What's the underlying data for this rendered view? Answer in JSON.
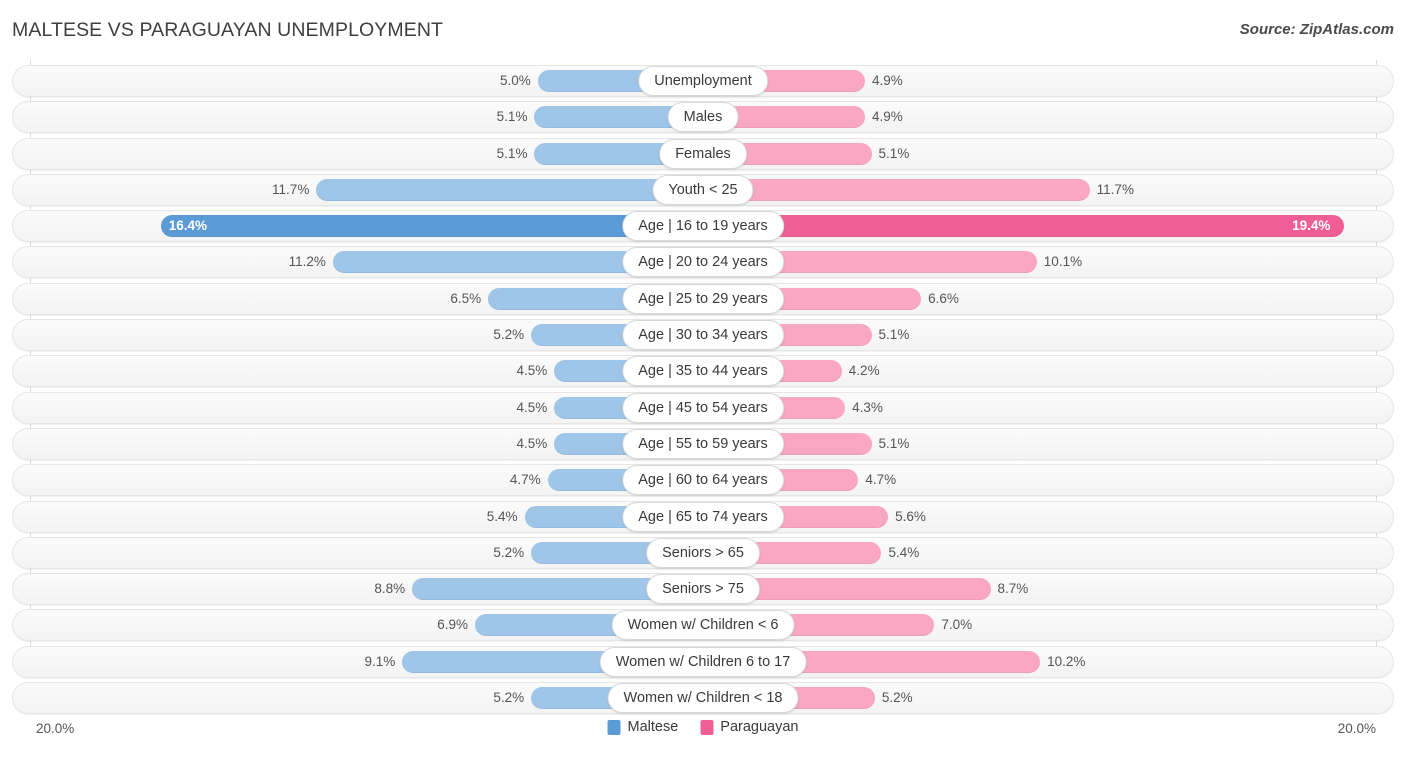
{
  "header": {
    "title": "MALTESE VS PARAGUAYAN UNEMPLOYMENT",
    "source": "Source: ZipAtlas.com"
  },
  "axis": {
    "left_label": "20.0%",
    "right_label": "20.0%",
    "max": 20.0
  },
  "legend": [
    {
      "label": "Maltese",
      "color": "#5b9bd5"
    },
    {
      "label": "Paraguayan",
      "color": "#ef5f95"
    }
  ],
  "colors": {
    "maltese_light": "#9fc5e8",
    "maltese_dark": "#5b9bd5",
    "paraguayan_light": "#f9a7c3",
    "paraguayan_dark": "#ef5f95",
    "track": "#f5f5f5",
    "gridline": "#dcdcdc"
  },
  "chart_data": {
    "type": "bar",
    "orientation": "horizontal-diverging",
    "title": "MALTESE VS PARAGUAYAN UNEMPLOYMENT",
    "xlabel": "",
    "ylabel": "",
    "xlim": [
      -20.0,
      20.0
    ],
    "grid": true,
    "legend_position": "bottom-center",
    "categories": [
      "Unemployment",
      "Males",
      "Females",
      "Youth < 25",
      "Age | 16 to 19 years",
      "Age | 20 to 24 years",
      "Age | 25 to 29 years",
      "Age | 30 to 34 years",
      "Age | 35 to 44 years",
      "Age | 45 to 54 years",
      "Age | 55 to 59 years",
      "Age | 60 to 64 years",
      "Age | 65 to 74 years",
      "Seniors > 65",
      "Seniors > 75",
      "Women w/ Children < 6",
      "Women w/ Children 6 to 17",
      "Women w/ Children < 18"
    ],
    "series": [
      {
        "name": "Maltese",
        "values": [
          5.0,
          5.1,
          5.1,
          11.7,
          16.4,
          11.2,
          6.5,
          5.2,
          4.5,
          4.5,
          4.5,
          4.7,
          5.4,
          5.2,
          8.8,
          6.9,
          9.1,
          5.2
        ]
      },
      {
        "name": "Paraguayan",
        "values": [
          4.9,
          4.9,
          5.1,
          11.7,
          19.4,
          10.1,
          6.6,
          5.1,
          4.2,
          4.3,
          5.1,
          4.7,
          5.6,
          5.4,
          8.7,
          7.0,
          10.2,
          5.2
        ]
      }
    ]
  },
  "rows": [
    {
      "label": "Unemployment",
      "left_value": 5.0,
      "right_value": 4.9,
      "left_text": "5.0%",
      "right_text": "4.9%",
      "highlight": false
    },
    {
      "label": "Males",
      "left_value": 5.1,
      "right_value": 4.9,
      "left_text": "5.1%",
      "right_text": "4.9%",
      "highlight": false
    },
    {
      "label": "Females",
      "left_value": 5.1,
      "right_value": 5.1,
      "left_text": "5.1%",
      "right_text": "5.1%",
      "highlight": false
    },
    {
      "label": "Youth < 25",
      "left_value": 11.7,
      "right_value": 11.7,
      "left_text": "11.7%",
      "right_text": "11.7%",
      "highlight": false
    },
    {
      "label": "Age | 16 to 19 years",
      "left_value": 16.4,
      "right_value": 19.4,
      "left_text": "16.4%",
      "right_text": "19.4%",
      "highlight": true
    },
    {
      "label": "Age | 20 to 24 years",
      "left_value": 11.2,
      "right_value": 10.1,
      "left_text": "11.2%",
      "right_text": "10.1%",
      "highlight": false
    },
    {
      "label": "Age | 25 to 29 years",
      "left_value": 6.5,
      "right_value": 6.6,
      "left_text": "6.5%",
      "right_text": "6.6%",
      "highlight": false
    },
    {
      "label": "Age | 30 to 34 years",
      "left_value": 5.2,
      "right_value": 5.1,
      "left_text": "5.2%",
      "right_text": "5.1%",
      "highlight": false
    },
    {
      "label": "Age | 35 to 44 years",
      "left_value": 4.5,
      "right_value": 4.2,
      "left_text": "4.5%",
      "right_text": "4.2%",
      "highlight": false
    },
    {
      "label": "Age | 45 to 54 years",
      "left_value": 4.5,
      "right_value": 4.3,
      "left_text": "4.5%",
      "right_text": "4.3%",
      "highlight": false
    },
    {
      "label": "Age | 55 to 59 years",
      "left_value": 4.5,
      "right_value": 5.1,
      "left_text": "4.5%",
      "right_text": "5.1%",
      "highlight": false
    },
    {
      "label": "Age | 60 to 64 years",
      "left_value": 4.7,
      "right_value": 4.7,
      "left_text": "4.7%",
      "right_text": "4.7%",
      "highlight": false
    },
    {
      "label": "Age | 65 to 74 years",
      "left_value": 5.4,
      "right_value": 5.6,
      "left_text": "5.4%",
      "right_text": "5.6%",
      "highlight": false
    },
    {
      "label": "Seniors > 65",
      "left_value": 5.2,
      "right_value": 5.4,
      "left_text": "5.2%",
      "right_text": "5.4%",
      "highlight": false
    },
    {
      "label": "Seniors > 75",
      "left_value": 8.8,
      "right_value": 8.7,
      "left_text": "8.8%",
      "right_text": "8.7%",
      "highlight": false
    },
    {
      "label": "Women w/ Children < 6",
      "left_value": 6.9,
      "right_value": 7.0,
      "left_text": "6.9%",
      "right_text": "7.0%",
      "highlight": false
    },
    {
      "label": "Women w/ Children 6 to 17",
      "left_value": 9.1,
      "right_value": 10.2,
      "left_text": "9.1%",
      "right_text": "10.2%",
      "highlight": false
    },
    {
      "label": "Women w/ Children < 18",
      "left_value": 5.2,
      "right_value": 5.2,
      "left_text": "5.2%",
      "right_text": "5.2%",
      "highlight": false
    }
  ]
}
